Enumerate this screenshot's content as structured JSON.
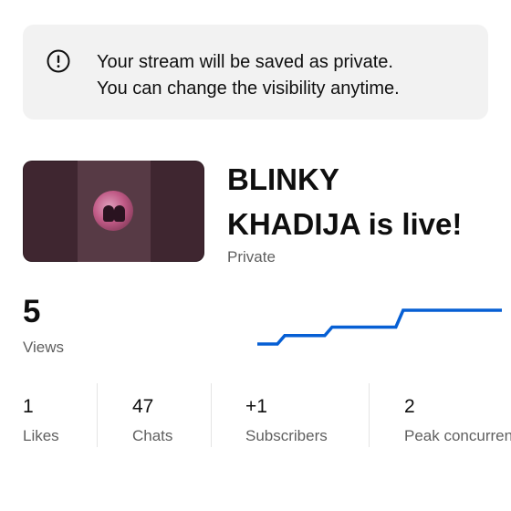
{
  "notice": {
    "icon": "info-circle-icon",
    "line1": "Your stream will be saved as private.",
    "line2": "You can change the visibility anytime."
  },
  "stream": {
    "thumbnail_icon": "stream-thumbnail",
    "title_line1": "BLINKY",
    "title_line2": "KHADIJA is live!",
    "visibility": "Private"
  },
  "views": {
    "count": "5",
    "label": "Views",
    "trend": [
      1,
      2,
      2,
      3,
      3,
      3,
      5,
      5,
      5,
      5,
      5
    ],
    "line_color": "#065fd4"
  },
  "stats": [
    {
      "value": "1",
      "label": "Likes"
    },
    {
      "value": "47",
      "label": "Chats"
    },
    {
      "value": "+1",
      "label": "Subscribers"
    },
    {
      "value": "2",
      "label": "Peak concurrent"
    }
  ]
}
